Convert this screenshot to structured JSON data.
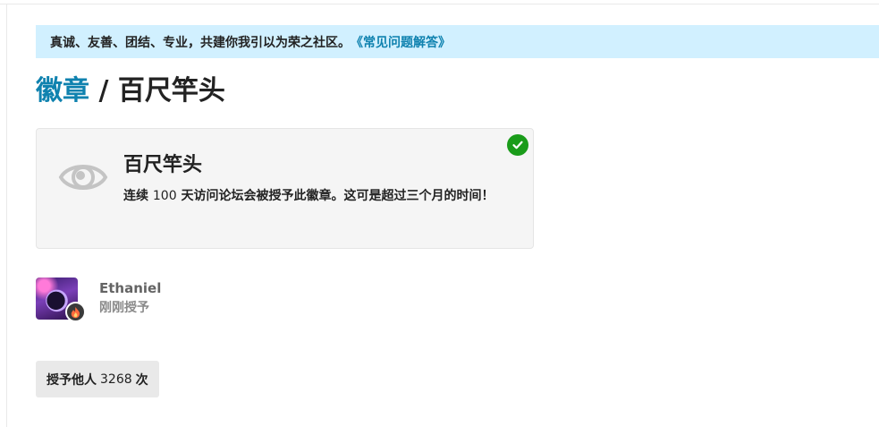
{
  "banner": {
    "text": "真诚、友善、团结、专业，共建你我引以为荣之社区。",
    "link": "《常见问题解答》"
  },
  "breadcrumb": {
    "parent": "徽章",
    "separator": " / ",
    "current": "百尺竿头"
  },
  "badge": {
    "icon": "eye-icon",
    "name": "百尺竿头",
    "desc_prefix": "连续 ",
    "desc_number": "100",
    "desc_suffix": " 天访问论坛会被授予此徽章。这可是超过三个月的时间！",
    "granted_icon": "check-circle-icon"
  },
  "grantee": {
    "username": "Ethaniel",
    "granted_time": "刚刚授予",
    "flair_icon": "flame-icon"
  },
  "granted_count": {
    "prefix": "授予他人",
    "count": "3268",
    "suffix": "次"
  },
  "colors": {
    "link": "#0f82af",
    "banner_bg": "#d1f0ff",
    "check": "#1a9c1a"
  }
}
